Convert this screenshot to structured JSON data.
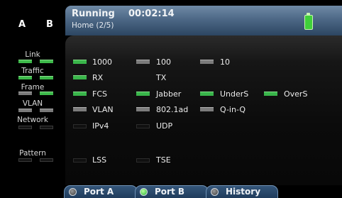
{
  "left_rail": {
    "port_a": "A",
    "port_b": "B",
    "groups": [
      {
        "label": "Link",
        "a": "on",
        "b": "on"
      },
      {
        "label": "Traffic",
        "a": "on",
        "b": "on"
      },
      {
        "label": "Frame",
        "a": "gray",
        "b": "on"
      },
      {
        "label": "VLAN",
        "a": "gray",
        "b": "gray"
      },
      {
        "label": "Network",
        "a": "off",
        "b": "off"
      },
      {
        "label": "Pattern",
        "a": "off",
        "b": "off"
      }
    ]
  },
  "header": {
    "status": "Running",
    "page": "Home (2/5)",
    "elapsed": "00:02:14",
    "battery_icon": "battery-full-icon"
  },
  "indicators": {
    "row1": [
      {
        "label": "1000",
        "state": "on"
      },
      {
        "label": "100",
        "state": "gray"
      },
      {
        "label": "10",
        "state": "gray"
      }
    ],
    "row2": [
      {
        "label": "RX",
        "state": "on"
      },
      {
        "label": "TX",
        "state": "none"
      }
    ],
    "row3": [
      {
        "label": "FCS",
        "state": "on"
      },
      {
        "label": "Jabber",
        "state": "on"
      },
      {
        "label": "UnderS",
        "state": "on"
      },
      {
        "label": "OverS",
        "state": "on"
      }
    ],
    "row4": [
      {
        "label": "VLAN",
        "state": "gray"
      },
      {
        "label": "802.1ad",
        "state": "gray"
      },
      {
        "label": "Q-in-Q",
        "state": "gray"
      }
    ],
    "row5": [
      {
        "label": "IPv4",
        "state": "off"
      },
      {
        "label": "UDP",
        "state": "off"
      }
    ],
    "row6": [
      {
        "label": "LSS",
        "state": "off"
      },
      {
        "label": "TSE",
        "state": "off"
      }
    ]
  },
  "tabs": [
    {
      "label": "Port A",
      "led": "gray"
    },
    {
      "label": "Port B",
      "led": "green"
    },
    {
      "label": "History",
      "led": "gray"
    }
  ],
  "colors": {
    "led_green": "#39b54a",
    "led_gray": "#7b7b7b",
    "header_blue": "#4d6886",
    "tab_blue": "#2a4a6e"
  }
}
